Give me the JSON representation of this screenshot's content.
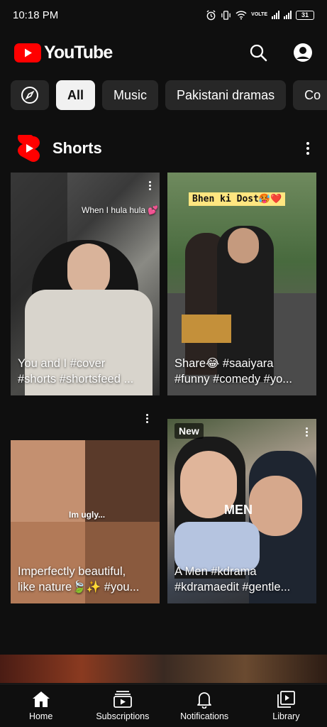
{
  "status_bar": {
    "time": "10:18 PM",
    "network": "VOLTE",
    "battery": "31"
  },
  "header": {
    "logo_text": "YouTube",
    "brand_color": "#ff0000",
    "icons": [
      "search-icon",
      "account-icon"
    ]
  },
  "chips": {
    "explore_icon": "compass-icon",
    "items": [
      "All",
      "Music",
      "Pakistani dramas",
      "Co"
    ]
  },
  "shorts_section": {
    "title": "Shorts",
    "items": [
      {
        "caption_line1": "You and I #cover",
        "caption_line2": "#shorts #shortsfeed ...",
        "overlay": "When I hula hula 💕"
      },
      {
        "caption_line1": "Share😂 #saaiyara",
        "caption_line2": "#funny #comedy #yo...",
        "overlay": "Bhen ki Dost🥵❤️"
      },
      {
        "caption_line1": "Imperfectly beautiful,",
        "caption_line2": "like nature🍃✨ #you...",
        "overlay": "Im ugly..."
      },
      {
        "caption_line1": "A Men #kdrama",
        "caption_line2": "#kdramaedit #gentle...",
        "overlay": "MEN",
        "badge": "New"
      }
    ]
  },
  "bottom_nav": {
    "items": [
      "Home",
      "Subscriptions",
      "Notifications",
      "Library"
    ]
  }
}
